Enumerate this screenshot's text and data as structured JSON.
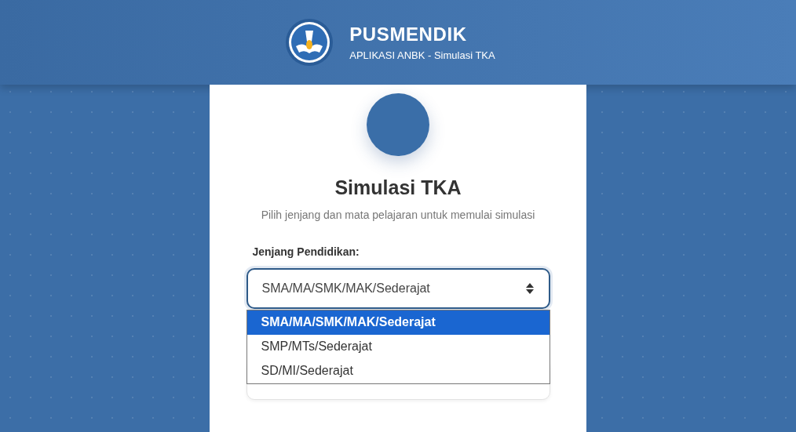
{
  "header": {
    "title": "PUSMENDIK",
    "subtitle": "APLIKASI ANBK - Simulasi TKA"
  },
  "card": {
    "title": "Simulasi TKA",
    "description": "Pilih jenjang dan mata pelajaran untuk memulai simulasi"
  },
  "education_level": {
    "label": "Jenjang Pendidikan:",
    "value": "SMA/MA/SMK/MAK/Sederajat",
    "expanded": true,
    "options": [
      {
        "label": "SMA/MA/SMK/MAK/Sederajat",
        "selected": true
      },
      {
        "label": "SMP/MTs/Sederajat",
        "selected": false
      },
      {
        "label": "SD/MI/Sederajat",
        "selected": false
      }
    ]
  }
}
